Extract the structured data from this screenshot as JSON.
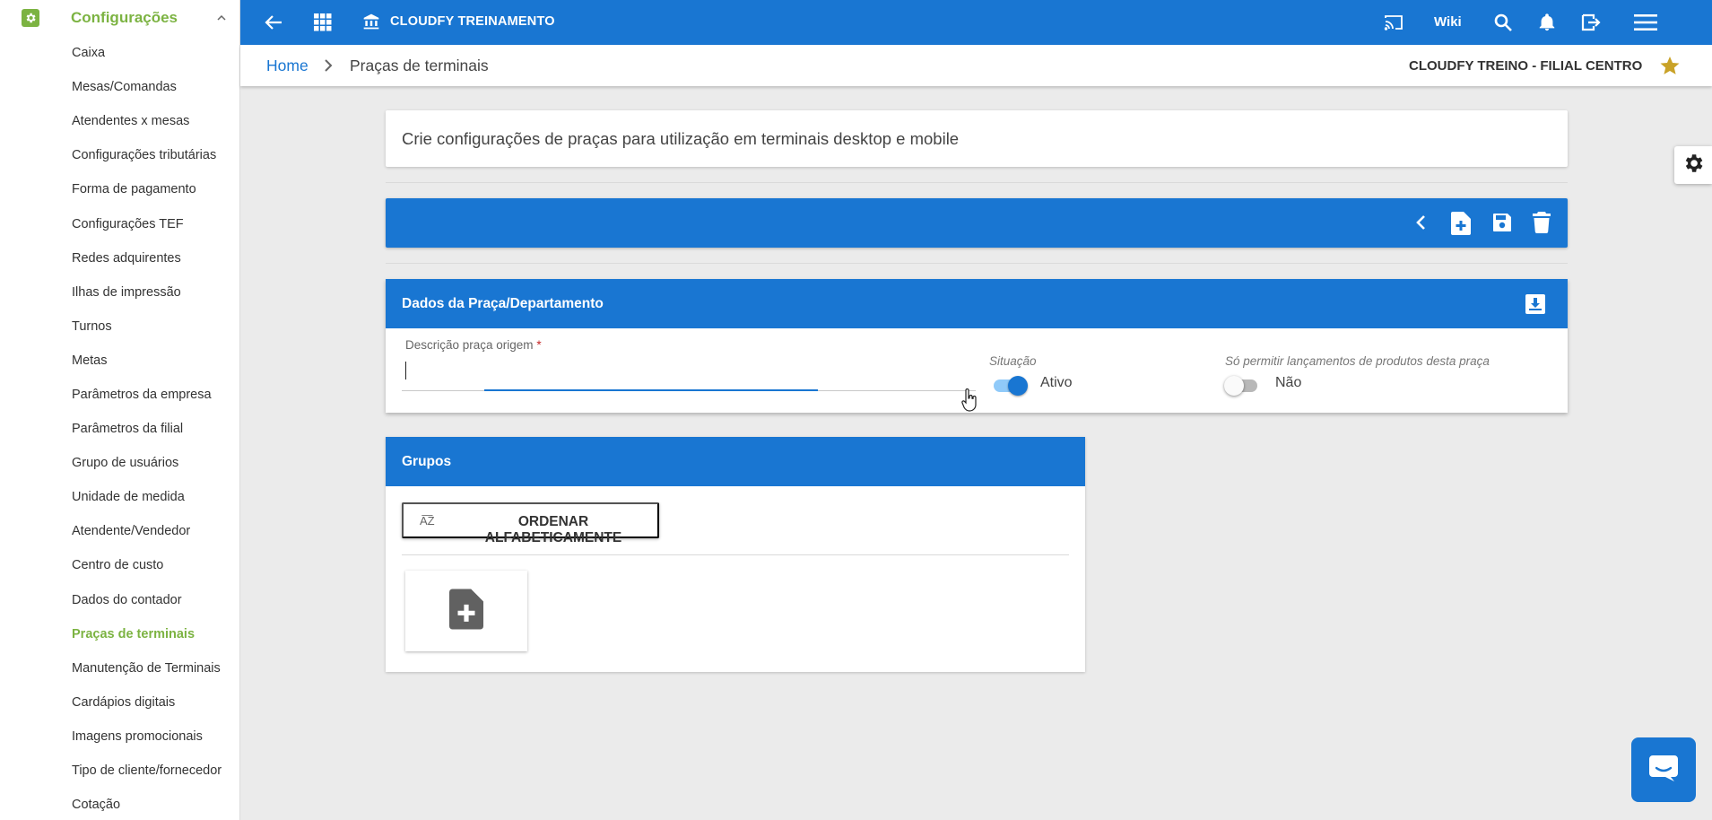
{
  "sidebar": {
    "section_title": "Configurações",
    "items": [
      {
        "label": "Caixa"
      },
      {
        "label": "Mesas/Comandas"
      },
      {
        "label": "Atendentes x mesas"
      },
      {
        "label": "Configurações tributárias"
      },
      {
        "label": "Forma de pagamento"
      },
      {
        "label": "Configurações TEF"
      },
      {
        "label": "Redes adquirentes"
      },
      {
        "label": "Ilhas de impressão"
      },
      {
        "label": "Turnos"
      },
      {
        "label": "Metas"
      },
      {
        "label": "Parâmetros da empresa"
      },
      {
        "label": "Parâmetros da filial"
      },
      {
        "label": "Grupo de usuários"
      },
      {
        "label": "Unidade de medida"
      },
      {
        "label": "Atendente/Vendedor"
      },
      {
        "label": "Centro de custo"
      },
      {
        "label": "Dados do contador"
      },
      {
        "label": "Praças de terminais",
        "active": true
      },
      {
        "label": "Manutenção de Terminais"
      },
      {
        "label": "Cardápios digitais"
      },
      {
        "label": "Imagens promocionais"
      },
      {
        "label": "Tipo de cliente/fornecedor"
      },
      {
        "label": "Cotação"
      }
    ]
  },
  "topbar": {
    "company_name": "CLOUDFY TREINAMENTO",
    "wiki_label": "Wiki",
    "icons": [
      "arrow-back-icon",
      "apps-grid-icon",
      "bank-icon",
      "cast-icon",
      "search-icon",
      "bell-icon",
      "exit-icon",
      "menu-icon"
    ]
  },
  "breadcrumb": {
    "home": "Home",
    "current": "Praças de terminais",
    "branch": "CLOUDFY TREINO - FILIAL CENTRO"
  },
  "info": {
    "text": "Crie configurações de praças para utilização em terminais desktop e mobile"
  },
  "dados_panel": {
    "title": "Dados da Praça/Departamento",
    "description_label": "Descrição praça origem",
    "required_mark": "*",
    "description_value": "",
    "situacao_label": "Situação",
    "situacao_value": "Ativo",
    "situacao_on": true,
    "only_products_label": "Só permitir lançamentos de produtos desta praça",
    "only_products_value": "Não",
    "only_products_on": false
  },
  "grupos_panel": {
    "title": "Grupos",
    "sort_icon_text": "A͞Z",
    "sort_button_label": "ORDENAR ALFABETICAMENTE"
  },
  "colors": {
    "primary": "#1976d2",
    "accent_green": "#7cb342",
    "star": "#c9a227"
  }
}
